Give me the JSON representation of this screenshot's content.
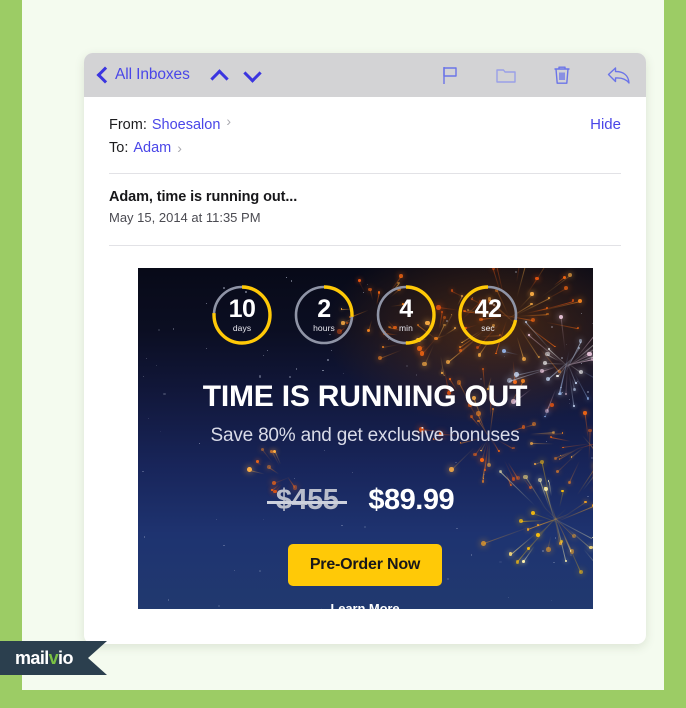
{
  "theme": {
    "outer_background": "#9ccc65",
    "panel_background": "#f4fbef",
    "card_background": "#ffffff",
    "toolbar_background": "#d3d3d5",
    "link_color": "#4a46e8",
    "accent_yellow": "#ffc907",
    "ribbon_dark": "#2b3f4e",
    "ribbon_green": "#7ac143"
  },
  "toolbar": {
    "back_icon": "chevron-left-icon",
    "back_label": "All Inboxes",
    "prev_icon": "chevron-up-icon",
    "next_icon": "chevron-down-icon",
    "actions": [
      {
        "name": "flag-icon",
        "label": "Flag"
      },
      {
        "name": "folder-icon",
        "label": "Move to folder"
      },
      {
        "name": "trash-icon",
        "label": "Delete"
      },
      {
        "name": "reply-icon",
        "label": "Reply"
      }
    ]
  },
  "message": {
    "from_label": "From:",
    "from_value": "Shoesalon",
    "to_label": "To:",
    "to_value": "Adam",
    "disclosure_arrow": "›",
    "hide_label": "Hide",
    "subject": "Adam, time is running out...",
    "date": "May 15, 2014 at 11:35 PM"
  },
  "promo": {
    "countdown": [
      {
        "value": "10",
        "unit": "days",
        "percent": 76,
        "start": 0,
        "direction": "cw"
      },
      {
        "value": "2",
        "unit": "hours",
        "percent": 26,
        "start": 0,
        "direction": "cw"
      },
      {
        "value": "4",
        "unit": "min",
        "percent": 50,
        "start": 0,
        "direction": "cw"
      },
      {
        "value": "42",
        "unit": "sec",
        "percent": 72,
        "start": 0,
        "direction": "ccw"
      }
    ],
    "headline": "TIME IS RUNNING OUT",
    "subheadline": "Save 80% and get exclusive bonuses",
    "old_price": "$455",
    "new_price": "$89.99",
    "cta_label": "Pre-Order Now",
    "learn_more_label": "Learn More"
  },
  "branding": {
    "name_part1": "mail",
    "name_accent": "v",
    "name_part2": "io"
  }
}
